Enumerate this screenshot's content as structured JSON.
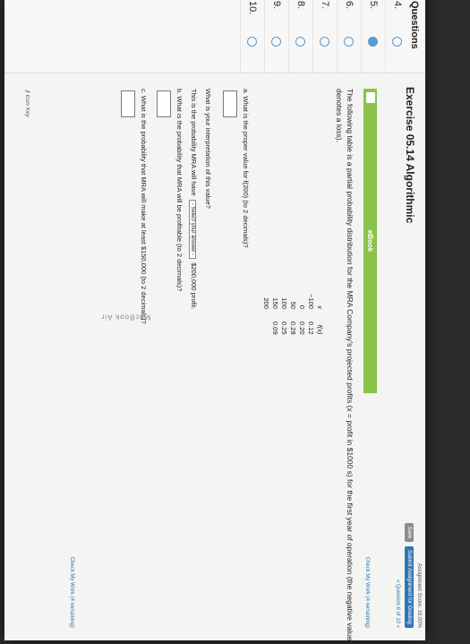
{
  "sidebar": {
    "title": "Questions",
    "items": [
      {
        "num": "4.",
        "state": "empty"
      },
      {
        "num": "5.",
        "state": "active"
      },
      {
        "num": "6.",
        "state": "empty"
      },
      {
        "num": "7.",
        "state": "empty"
      },
      {
        "num": "8.",
        "state": "empty"
      },
      {
        "num": "9.",
        "state": "empty"
      },
      {
        "num": "10.",
        "state": "empty"
      }
    ]
  },
  "header": {
    "exercise_title": "Exercise 05.14 Algorithmic",
    "score": "Assignment Score: 16.00%",
    "save_label": "Save",
    "submit_label": "Submit Assignment for Grading",
    "question_count": "« Question 6 of 10 »"
  },
  "check_top": "Check My Work (4 remaining)",
  "ebook_label": "eBook",
  "intro_text": "The following table is a partial probability distribution for the MRA Company's projected profits (x = profit in $1000 s) for the first year of operation (the negative value denotes a loss).",
  "table": {
    "headers": [
      "x",
      "f(x)"
    ],
    "rows": [
      [
        "−100",
        "0.12"
      ],
      [
        "0",
        "0.20"
      ],
      [
        "50",
        "0.28"
      ],
      [
        "100",
        "0.25"
      ],
      [
        "150",
        "0.09"
      ],
      [
        "200",
        ""
      ]
    ]
  },
  "questions": {
    "a": "a. What is the proper value for f(200) (to 2 decimals)?",
    "interp": "What is your interpretation of this value?",
    "prob_pre": "This is the probability MRA will have",
    "select_label": "- Select your answer -",
    "prob_post": "$200,000 profit.",
    "b": "b. What is the probability that MRA will be profitable (to 2 decimals)?",
    "c": "c. What is the probability that MRA will make at least $150,000 (to 2 decimals)?"
  },
  "check_bottom": "Check My Work (4 remaining)",
  "icon_key": "Icon Key",
  "bezel_brand": "MacBook Air",
  "colors": {
    "accent": "#2e75b6",
    "ebook": "#8bc34a"
  }
}
